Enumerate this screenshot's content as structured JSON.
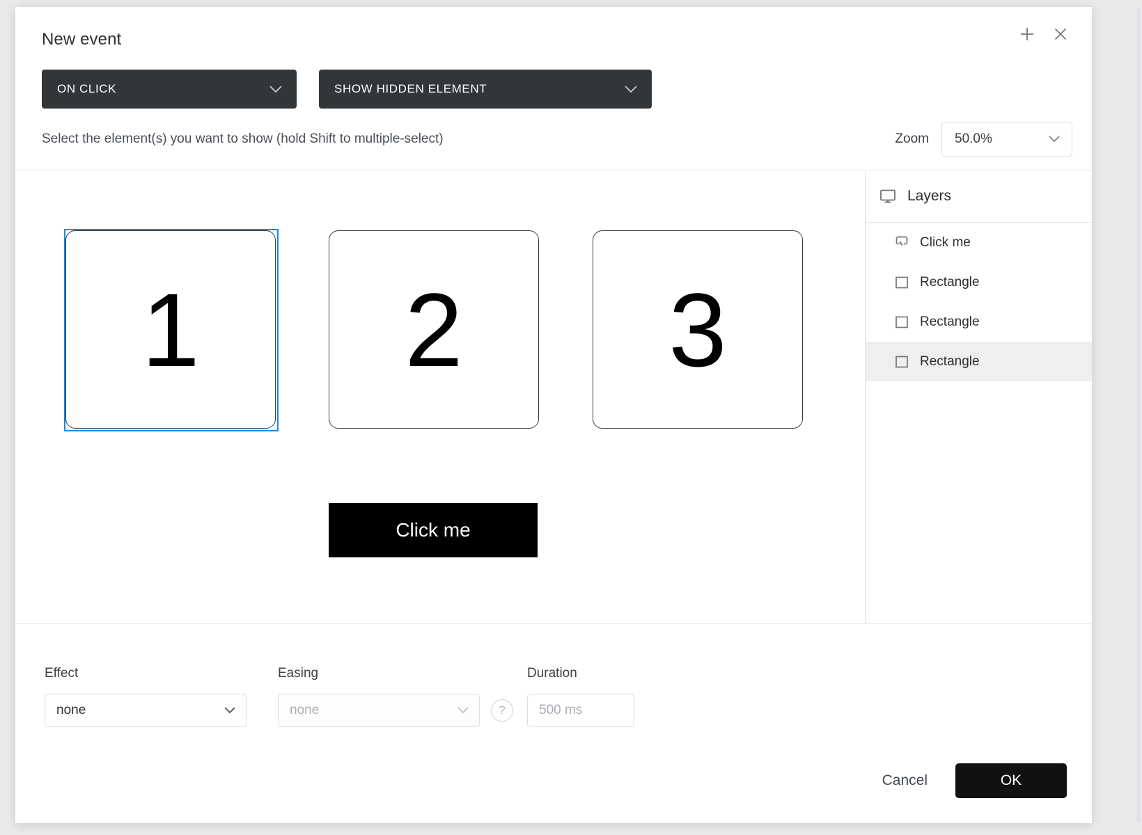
{
  "dialog": {
    "title": "New event",
    "add_icon": "plus-icon",
    "close_icon": "close-icon"
  },
  "triggers": {
    "event_select": {
      "value": "ON CLICK",
      "caret": "chevron-down-icon"
    },
    "action_select": {
      "value": "SHOW HIDDEN ELEMENT",
      "caret": "chevron-down-icon"
    }
  },
  "instruction": "Select the element(s) you want to show (hold Shift to multiple-select)",
  "zoom": {
    "label": "Zoom",
    "value": "50.0%",
    "caret": "chevron-down-icon"
  },
  "canvas": {
    "shapes": [
      {
        "label": "1",
        "selected": true
      },
      {
        "label": "2",
        "selected": false
      },
      {
        "label": "3",
        "selected": false
      }
    ],
    "cta": {
      "label": "Click me"
    }
  },
  "layers": {
    "title": "Layers",
    "title_icon": "monitor-icon",
    "items": [
      {
        "label": "Click me",
        "icon": "button-cursor-icon",
        "selected": false
      },
      {
        "label": "Rectangle",
        "icon": "square-icon",
        "selected": false
      },
      {
        "label": "Rectangle",
        "icon": "square-icon",
        "selected": false
      },
      {
        "label": "Rectangle",
        "icon": "square-icon",
        "selected": true
      }
    ]
  },
  "animation": {
    "effect": {
      "label": "Effect",
      "value": "none",
      "caret": "chevron-down-icon"
    },
    "easing": {
      "label": "Easing",
      "value": "none",
      "caret": "chevron-down-icon",
      "disabled": true
    },
    "help_icon": "question-mark-icon",
    "duration": {
      "label": "Duration",
      "placeholder": "500 ms",
      "value": ""
    }
  },
  "actions": {
    "cancel": "Cancel",
    "ok": "OK"
  },
  "colors": {
    "selection_blue": "#0d8ce8",
    "select_dark": "#323639",
    "primary_black": "#111111"
  }
}
